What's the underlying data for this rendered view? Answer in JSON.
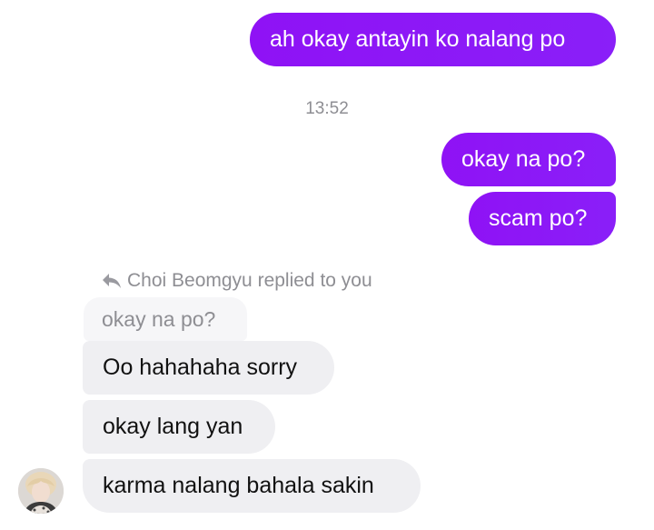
{
  "conversation": {
    "sent_messages": [
      "ah okay antayin ko nalang po",
      "okay na po?",
      "scam po?"
    ],
    "timestamp": "13:52",
    "reply": {
      "header": "Choi Beomgyu replied to you",
      "quoted_text": "okay na po?"
    },
    "received_messages": [
      "Oo hahahaha sorry",
      "okay lang yan",
      "karma nalang bahala sakin"
    ],
    "contact_avatar": "avatar-photo"
  },
  "colors": {
    "sent_bubble": "#8f12f5",
    "received_bubble": "#efeff2",
    "meta_text": "#8e8e93"
  }
}
